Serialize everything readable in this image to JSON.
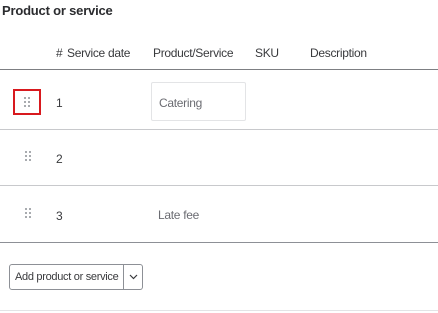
{
  "section": {
    "title": "Product or service"
  },
  "table": {
    "headers": {
      "number": "#",
      "service_date": "Service date",
      "product_service": "Product/Service",
      "sku": "SKU",
      "description": "Description"
    },
    "rows": [
      {
        "number": "1",
        "product_service": "Catering",
        "drag_icon": "drag-grip-icon",
        "highlighted": true
      },
      {
        "number": "2",
        "product_service": "",
        "drag_icon": "drag-grip-icon",
        "highlighted": false
      },
      {
        "number": "3",
        "product_service": "Late fee",
        "drag_icon": "drag-grip-icon",
        "highlighted": false
      }
    ]
  },
  "actions": {
    "add_label": "Add product or service",
    "dropdown_icon": "chevron-down-icon"
  },
  "colors": {
    "highlight": "#d8191e",
    "text": "#393a3d",
    "muted_text": "#6b6c72",
    "border": "#8d9096"
  }
}
